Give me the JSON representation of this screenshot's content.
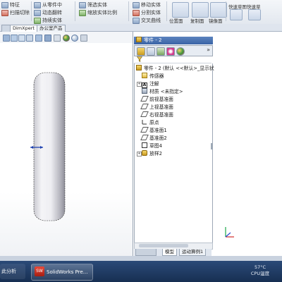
{
  "ribbon": {
    "items": [
      "特征",
      "扫描切除",
      "从零件中",
      "动态翻转",
      "持续实体",
      "筛选实体",
      "缩放实体比例",
      "移动实体",
      "分割实体",
      "交叉曲线",
      "位置面",
      "复制面",
      "镜像面"
    ],
    "big_buttons": [
      "快速草图",
      "快速草"
    ]
  },
  "tabs": [
    {
      "label": "DimXpert"
    },
    {
      "label": "办公室产品"
    }
  ],
  "viewport": {
    "toolbar_icons": [
      "zoom-fit-icon",
      "zoom-area-icon",
      "previous-view-icon",
      "section-view-icon",
      "view-orientation-icon",
      "display-style-icon",
      "hide-show-icon",
      "edit-appearance-icon",
      "scene-icon",
      "view-settings-icon"
    ],
    "colors": {
      "part_light": "#f7f7fa",
      "part_dark": "#9a9aa4",
      "dimension": "#1a3fb0"
    }
  },
  "panel": {
    "title": "零件 - 2",
    "header_icon": "part-icon",
    "tab_icons": [
      "feature-manager-icon",
      "property-manager-icon",
      "configuration-manager-icon",
      "dimxpert-manager-icon",
      "display-manager-icon"
    ],
    "filter_icon": "filter-icon",
    "expand_icon": "chevron-right-icon",
    "tree": [
      {
        "label": "零件 - 2  (默认 <<默认>_显示状",
        "icon": "part-icon"
      },
      {
        "label": "传感器",
        "icon": "sensor-icon"
      },
      {
        "label": "注解",
        "icon": "annotation-icon"
      },
      {
        "label": "材质 <未指定>",
        "icon": "material-icon"
      },
      {
        "label": "前视基准面",
        "icon": "plane-icon"
      },
      {
        "label": "上视基准面",
        "icon": "plane-icon"
      },
      {
        "label": "右视基准面",
        "icon": "plane-icon"
      },
      {
        "label": "原点",
        "icon": "origin-icon"
      },
      {
        "label": "基准面1",
        "icon": "plane-icon"
      },
      {
        "label": "基准面2",
        "icon": "plane-icon"
      },
      {
        "label": "草图4",
        "icon": "sketch-icon"
      },
      {
        "label": "放样2",
        "icon": "loft-icon"
      }
    ],
    "bottom_tabs": [
      "模型",
      "运动算例1"
    ]
  },
  "taskbar": {
    "left_label": "此分析",
    "app_label": "SolidWorks Pre...",
    "temperature": "57°C",
    "cpu_label": "CPU温度"
  }
}
